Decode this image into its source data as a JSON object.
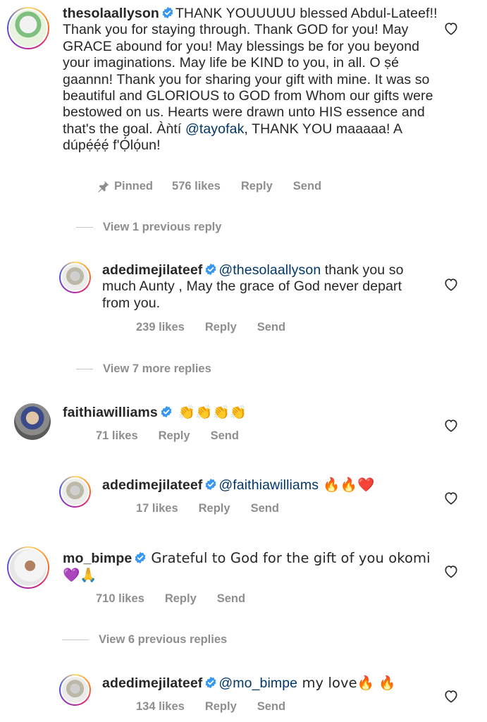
{
  "comments": [
    {
      "username": "thesolaallyson",
      "text": "THANK YOUUUUU blessed Abdul-Lateef!! Thank you for staying through. Thank GOD for you! May GRACE abound for you! May blessings be for you beyond your imaginations. May life be KIND to you, in all. O ṣé gaannn! Thank you for sharing your gift with mine. It was so beautiful and GLORIOUS to GOD from Whom our gifts were bestowed on us. Hearts were drawn unto HIS essence and that's the goal. Àǹtí ",
      "mention": "@tayofak",
      "text_after": ", THANK YOU maaaaa! A dúpẹ́ẹ́ẹ́ f'Ọ́lọ́un!",
      "pinned_label": "Pinned",
      "likes": "576 likes",
      "reply_label": "Reply",
      "send_label": "Send"
    },
    {
      "username": "adedimejilateef",
      "mention": "@thesolaallyson",
      "text": " thank you so much Aunty , May the grace of God never depart from you.",
      "likes": "239 likes",
      "reply_label": "Reply",
      "send_label": "Send"
    },
    {
      "username": "faithiawilliams",
      "text": "👏👏👏👏",
      "likes": "71 likes",
      "reply_label": "Reply",
      "send_label": "Send"
    },
    {
      "username": "adedimejilateef",
      "mention": "@faithiawilliams",
      "text": " 🔥🔥❤️",
      "likes": "17 likes",
      "reply_label": "Reply",
      "send_label": "Send"
    },
    {
      "username": "mo_bimpe",
      "text": "Grateful to God for the gift of you okomi 💜🙏",
      "likes": "710 likes",
      "reply_label": "Reply",
      "send_label": "Send"
    },
    {
      "username": "adedimejilateef",
      "mention": "@mo_bimpe",
      "text": " my love🔥 🔥",
      "likes": "134 likes",
      "reply_label": "Reply",
      "send_label": "Send"
    }
  ],
  "view_replies": [
    "View 1 previous reply",
    "View 7 more replies",
    "View 6 previous replies"
  ],
  "colors": {
    "text": "#262626",
    "meta": "#8e8e8e",
    "mention": "#00376b",
    "verified": "#3897f0"
  },
  "icons": {
    "verified": "verified-badge-icon",
    "heart": "heart-outline-icon",
    "pin": "pin-icon"
  }
}
